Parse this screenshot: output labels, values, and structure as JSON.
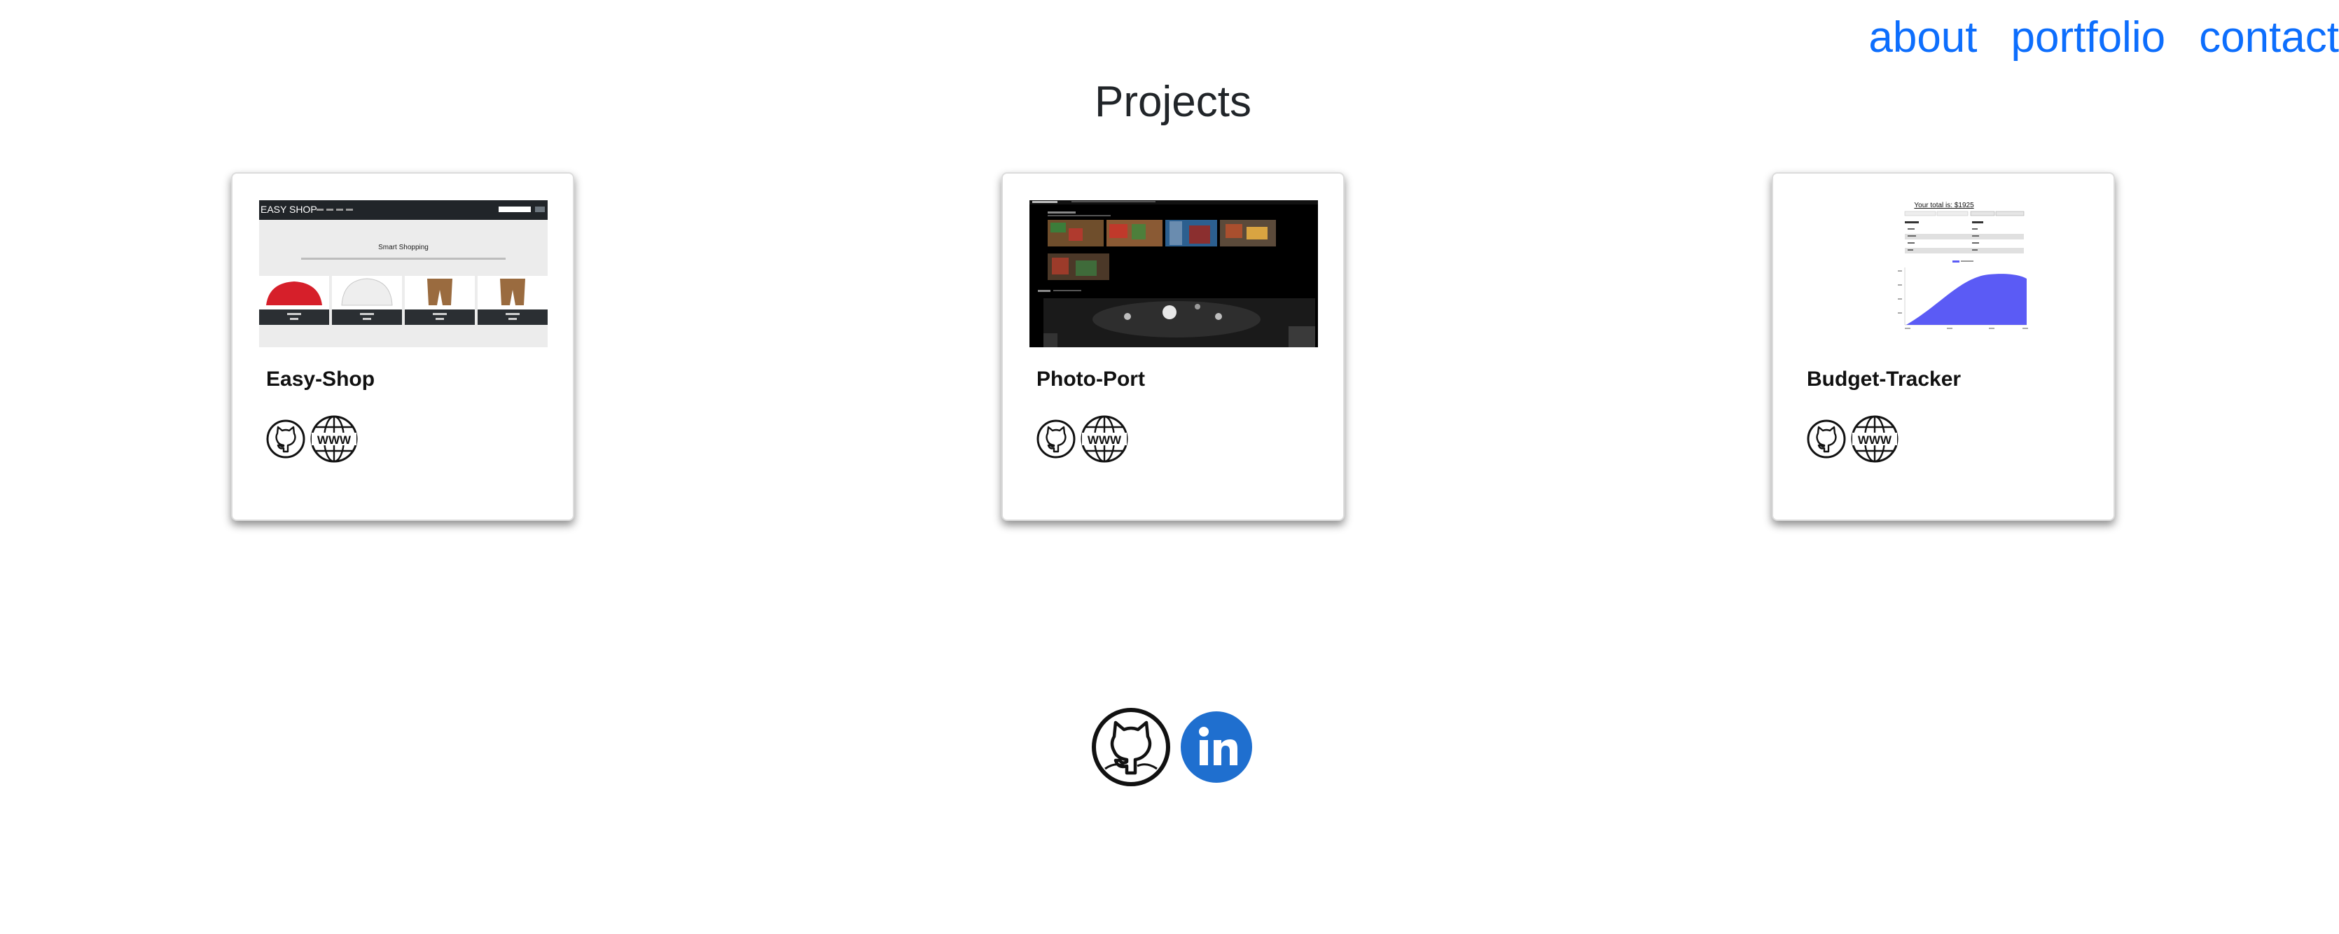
{
  "nav": {
    "about": "about",
    "portfolio": "portfolio",
    "contact": "contact"
  },
  "page": {
    "title": "Projects"
  },
  "projects": [
    {
      "title": "Easy-Shop",
      "thumb": {
        "brand": "EASY SHOP",
        "heading": "Smart Shopping"
      }
    },
    {
      "title": "Photo-Port"
    },
    {
      "title": "Budget-Tracker",
      "thumb": {
        "total": "Your total is: $1925"
      }
    }
  ],
  "colors": {
    "link": "#0d6efd",
    "linkedin": "#1f6fcf",
    "chart_fill": "#5b5bf5"
  },
  "icons": [
    "github-icon",
    "globe-www-icon",
    "linkedin-icon"
  ]
}
